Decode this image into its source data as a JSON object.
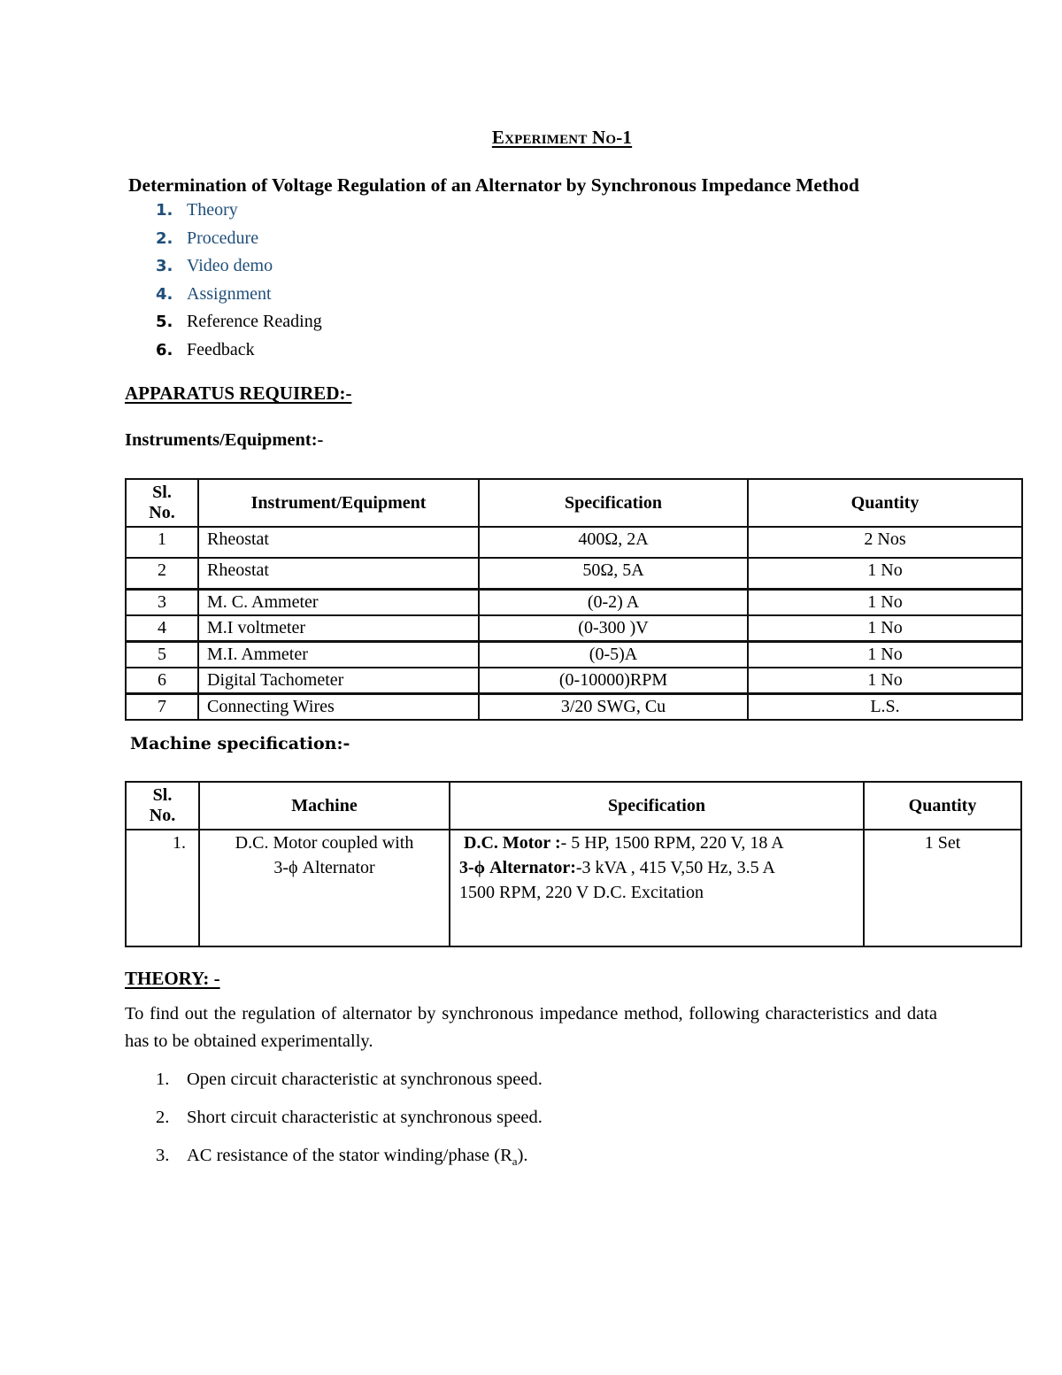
{
  "document": {
    "title": "Experiment No-1",
    "subtitle": "Determination of Voltage Regulation of an Alternator by Synchronous Impedance Method",
    "link_color": "#1f4e79",
    "toc": [
      {
        "num": "1.",
        "label": "Theory",
        "is_link": true
      },
      {
        "num": "2.",
        "label": "Procedure",
        "is_link": true
      },
      {
        "num": "3.",
        "label": "Video demo",
        "is_link": true
      },
      {
        "num": "4.",
        "label": "Assignment",
        "is_link": true
      },
      {
        "num": "5.",
        "label": "Reference Reading",
        "is_link": false
      },
      {
        "num": "6.",
        "label": "Feedback",
        "is_link": false
      }
    ]
  },
  "apparatus": {
    "heading": "APPARATUS REQUIRED:-",
    "instruments_heading": "Instruments/Equipment:-",
    "instruments_table": {
      "headers": [
        "Sl. No.",
        "Instrument/Equipment",
        "Specification",
        "Quantity"
      ],
      "rows": [
        [
          "1",
          "Rheostat",
          "400Ω, 2A",
          "2 Nos"
        ],
        [
          "2",
          "Rheostat",
          "50Ω, 5A",
          "1 No"
        ],
        [
          "3",
          "M. C. Ammeter",
          "(0-2) A",
          "1 No"
        ],
        [
          "4",
          "M.I voltmeter",
          "(0-300 )V",
          "1 No"
        ],
        [
          "5",
          "M.I. Ammeter",
          "(0-5)A",
          "1 No"
        ],
        [
          "6",
          "Digital Tachometer",
          "(0-10000)RPM",
          "1 No"
        ],
        [
          "7",
          "Connecting Wires",
          "3/20 SWG, Cu",
          "L.S."
        ]
      ]
    },
    "machine_heading": "Machine specification:-",
    "machine_table": {
      "headers": [
        "Sl. No.",
        "Machine",
        "Specification",
        "Quantity"
      ],
      "rows": [
        {
          "sl": "1.",
          "machine_line1": "D.C. Motor coupled with",
          "machine_line2": "3-ϕ  Alternator",
          "spec_motor_label": "D.C. Motor :",
          "spec_motor_value": "- 5 HP, 1500 RPM, 220 V, 18 A",
          "spec_alt_label": "3-ϕ Alternator:",
          "spec_alt_value": "-3 kVA , 415 V,50 Hz, 3.5 A",
          "spec_line3": "1500 RPM, 220 V D.C. Excitation",
          "quantity": "1 Set"
        }
      ]
    }
  },
  "theory": {
    "heading": "THEORY: -",
    "paragraph": "To find out the regulation of alternator by synchronous impedance method, following characteristics and data has to be obtained experimentally.",
    "items": [
      {
        "num": "1.",
        "text": "Open circuit characteristic at synchronous speed."
      },
      {
        "num": "2.",
        "text": "Short circuit characteristic at synchronous speed."
      },
      {
        "num": "3.",
        "text_before": "AC resistance of the stator winding/phase (R",
        "sub": "a",
        "text_after": ")."
      }
    ]
  }
}
